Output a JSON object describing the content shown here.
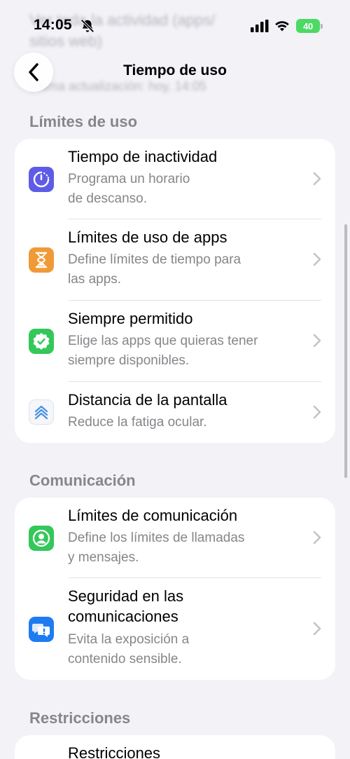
{
  "status_bar": {
    "time": "14:05",
    "battery": "40"
  },
  "background_text": {
    "line1": "Ver toda la actividad (apps/",
    "line2": "sitios web)",
    "line3": "Última actualización: hoy, 14:05"
  },
  "nav": {
    "title": "Tiempo de uso"
  },
  "sections": {
    "limits": {
      "header": "Límites de uso",
      "items": [
        {
          "title": "Tiempo de inactividad",
          "subtitle1": "Programa un horario",
          "subtitle2": "de descanso.",
          "icon": "downtime-icon",
          "color": "#5e5ce6"
        },
        {
          "title": "Límites de uso de apps",
          "subtitle1": "Define límites de tiempo para",
          "subtitle2": "las apps.",
          "icon": "hourglass-icon",
          "color": "#f09a37"
        },
        {
          "title": "Siempre permitido",
          "subtitle1": "Elige las apps que quieras tener",
          "subtitle2": "siempre disponibles.",
          "icon": "checkmark-seal-icon",
          "color": "#34c759"
        },
        {
          "title": "Distancia de la pantalla",
          "subtitle1": "Reduce la fatiga ocular.",
          "icon": "screen-distance-icon",
          "color": "#4a90e2"
        }
      ]
    },
    "communication": {
      "header": "Comunicación",
      "items": [
        {
          "title": "Límites de comunicación",
          "subtitle1": "Define los límites de llamadas",
          "subtitle2": "y mensajes.",
          "icon": "person-circle-icon",
          "color": "#34c759"
        },
        {
          "title1": "Seguridad en las",
          "title2": "comunicaciones",
          "subtitle1": "Evita la exposición a",
          "subtitle2": "contenido sensible.",
          "icon": "chat-bubble-exclamation-icon",
          "color": "#1e7cf2"
        }
      ]
    },
    "restrictions": {
      "header": "Restricciones",
      "items": [
        {
          "title": "Restricciones"
        }
      ]
    }
  }
}
